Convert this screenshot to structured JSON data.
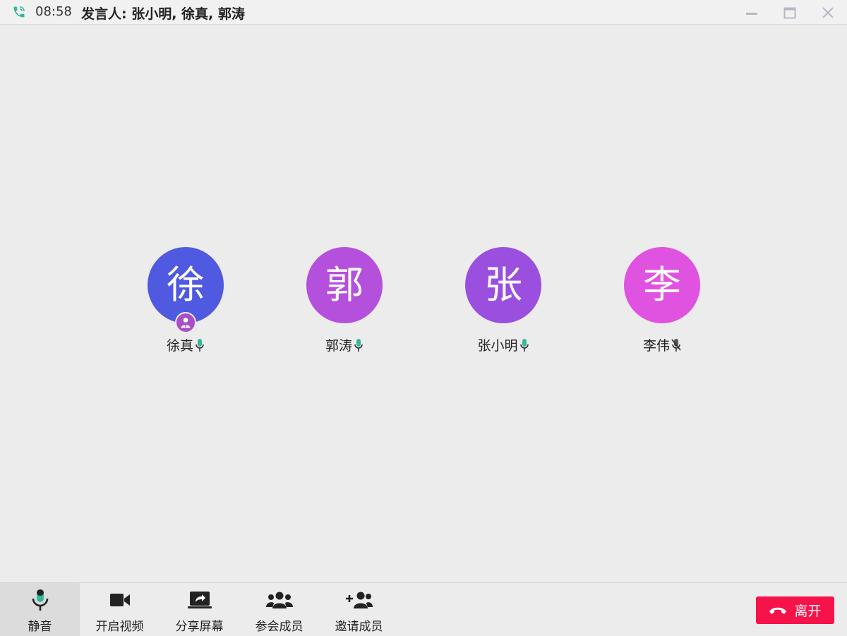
{
  "titlebar": {
    "icon": "phone-call-icon",
    "time": "08:58",
    "speakers_label": "发言人: 张小明, 徐真, 郭涛",
    "colors": {
      "phone_icon": "#35b89a"
    },
    "window_controls": [
      "minimize-icon",
      "maximize-icon",
      "close-icon"
    ]
  },
  "participants": [
    {
      "avatar_char": "徐",
      "name": "徐真",
      "color": "#4f5ae0",
      "mic": "on",
      "host": true
    },
    {
      "avatar_char": "郭",
      "name": "郭涛",
      "color": "#b550dc",
      "mic": "on",
      "host": false
    },
    {
      "avatar_char": "张",
      "name": "张小明",
      "color": "#9a4fdf",
      "mic": "on",
      "host": false
    },
    {
      "avatar_char": "李",
      "name": "李伟",
      "color": "#e052e0",
      "mic": "off",
      "host": false
    }
  ],
  "toolbar": {
    "mute_label": "静音",
    "video_label": "开启视频",
    "share_label": "分享屏幕",
    "members_label": "参会成员",
    "invite_label": "邀请成员",
    "leave_label": "离开",
    "colors": {
      "leave": "#f5134a",
      "mic_accent": "#35b89a"
    }
  }
}
